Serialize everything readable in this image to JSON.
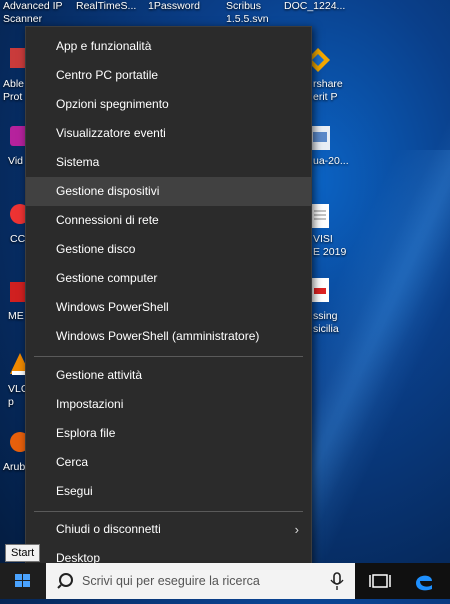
{
  "desktop_icons": [
    {
      "label": "Advanced IP\nScanner",
      "id": "advanced-ip"
    },
    {
      "label": "RealTimeS...",
      "id": "realtimes"
    },
    {
      "label": "1Password",
      "id": "onepassword"
    },
    {
      "label": "Scribus\n1.5.5.svn",
      "id": "scribus"
    },
    {
      "label": "DOC_1224...",
      "id": "doc1224"
    },
    {
      "label": "Able\nProt",
      "id": "able"
    },
    {
      "label": "rshare\nerit P",
      "id": "wondershare"
    },
    {
      "label": "Vid",
      "id": "vid"
    },
    {
      "label": "ua-20...",
      "id": "ua20"
    },
    {
      "label": "CC",
      "id": "cc"
    },
    {
      "label": "VISI\nE 2019",
      "id": "visi"
    },
    {
      "label": "ME",
      "id": "me"
    },
    {
      "label": "ssing\nsicilia",
      "id": "sicilia"
    },
    {
      "label": "VLC\np",
      "id": "vlc"
    },
    {
      "label": "Arub",
      "id": "arub"
    }
  ],
  "menu": {
    "items": [
      {
        "label": "App e funzionalità",
        "name": "menu-item-app-funzionalita"
      },
      {
        "label": "Centro PC portatile",
        "name": "menu-item-centro-pc-portatile"
      },
      {
        "label": "Opzioni spegnimento",
        "name": "menu-item-opzioni-spegnimento"
      },
      {
        "label": "Visualizzatore eventi",
        "name": "menu-item-visualizzatore-eventi"
      },
      {
        "label": "Sistema",
        "name": "menu-item-sistema"
      },
      {
        "label": "Gestione dispositivi",
        "name": "menu-item-gestione-dispositivi"
      },
      {
        "label": "Connessioni di rete",
        "name": "menu-item-connessioni-rete"
      },
      {
        "label": "Gestione disco",
        "name": "menu-item-gestione-disco"
      },
      {
        "label": "Gestione computer",
        "name": "menu-item-gestione-computer"
      },
      {
        "label": "Windows PowerShell",
        "name": "menu-item-windows-powershell"
      },
      {
        "label": "Windows PowerShell (amministratore)",
        "name": "menu-item-powershell-admin"
      },
      {
        "label": "Gestione attività",
        "name": "menu-item-gestione-attivita"
      },
      {
        "label": "Impostazioni",
        "name": "menu-item-impostazioni"
      },
      {
        "label": "Esplora file",
        "name": "menu-item-esplora-file"
      },
      {
        "label": "Cerca",
        "name": "menu-item-cerca"
      },
      {
        "label": "Esegui",
        "name": "menu-item-esegui"
      },
      {
        "label": "Chiudi o disconnetti",
        "name": "menu-item-chiudi-disconnetti"
      },
      {
        "label": "Desktop",
        "name": "menu-item-desktop"
      }
    ],
    "hovered_item": "Gestione dispositivi"
  },
  "tooltip": {
    "text": "Start"
  },
  "taskbar": {
    "search_placeholder": "Scrivi qui per eseguire la ricerca"
  },
  "colors": {
    "menu_bg": "#2b2b2b",
    "menu_hover": "#414141",
    "taskbar_bg": "#101010",
    "edge_blue": "#1e90ff"
  }
}
